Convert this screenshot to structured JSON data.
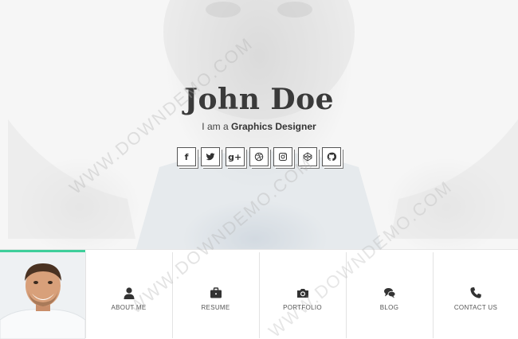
{
  "hero": {
    "name": "John Doe",
    "tagline_prefix": "I am a",
    "tagline_role": "Graphics Designer"
  },
  "social": [
    {
      "name": "facebook-icon",
      "glyph": "f"
    },
    {
      "name": "twitter-icon",
      "glyph": ""
    },
    {
      "name": "google-plus-icon",
      "glyph": "g+"
    },
    {
      "name": "dribbble-icon",
      "glyph": ""
    },
    {
      "name": "instagram-icon",
      "glyph": ""
    },
    {
      "name": "codepen-icon",
      "glyph": ""
    },
    {
      "name": "github-icon",
      "glyph": ""
    }
  ],
  "nav": {
    "items": [
      {
        "label": "ABOUT ME",
        "icon": "user-icon"
      },
      {
        "label": "RESUME",
        "icon": "briefcase-icon"
      },
      {
        "label": "PORTFOLIO",
        "icon": "camera-icon"
      },
      {
        "label": "BLOG",
        "icon": "comments-icon"
      },
      {
        "label": "CONTACT US",
        "icon": "phone-icon"
      }
    ]
  },
  "watermark": "WWW.DOWNDEMO.COM",
  "colors": {
    "accent": "#3ecf9b",
    "text": "#333333",
    "border": "#e3e3e3"
  }
}
